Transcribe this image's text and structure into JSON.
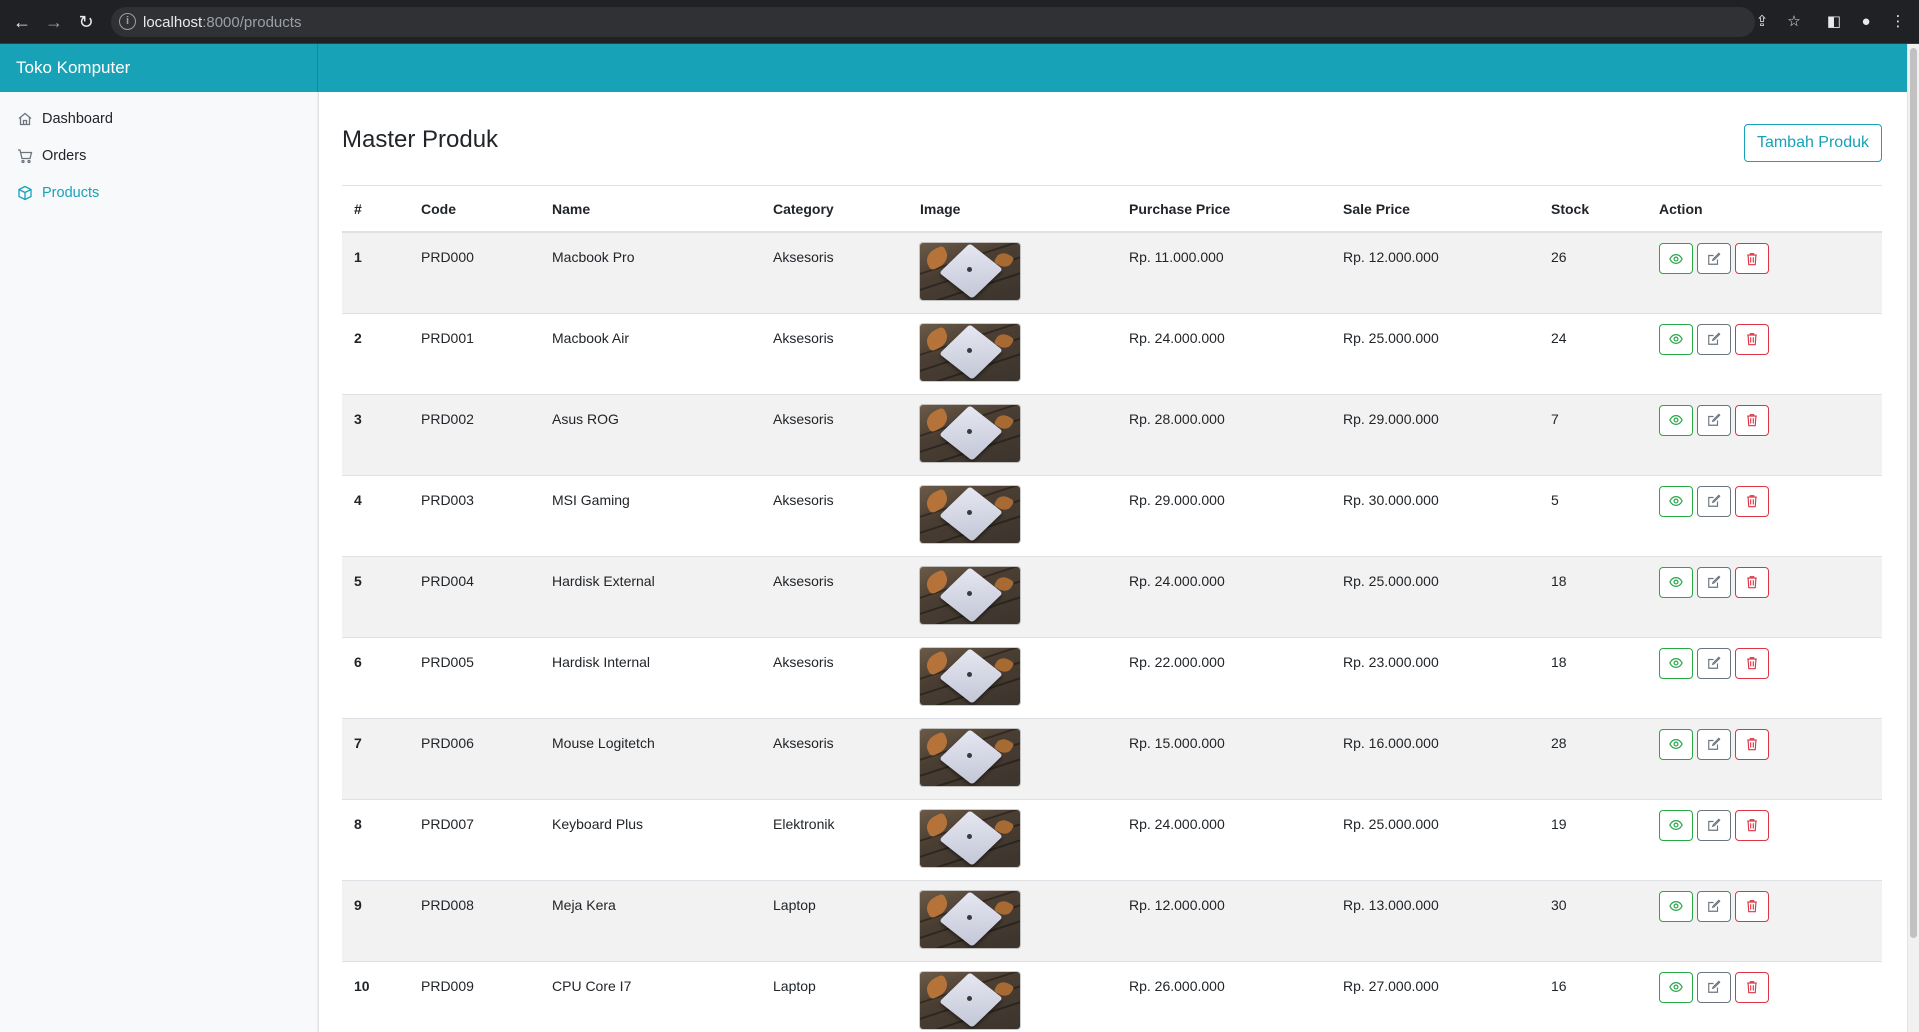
{
  "browser": {
    "url_host": "localhost",
    "url_path": ":8000/products"
  },
  "app": {
    "brand": "Toko Komputer"
  },
  "sidebar": {
    "items": [
      {
        "label": "Dashboard",
        "icon": "home-icon",
        "active": false
      },
      {
        "label": "Orders",
        "icon": "cart-icon",
        "active": false
      },
      {
        "label": "Products",
        "icon": "box-icon",
        "active": true
      }
    ]
  },
  "main": {
    "title": "Master Produk",
    "add_button": "Tambah Produk"
  },
  "table": {
    "headers": [
      "#",
      "Code",
      "Name",
      "Category",
      "Image",
      "Purchase Price",
      "Sale Price",
      "Stock",
      "Action"
    ],
    "rows": [
      {
        "num": "1",
        "code": "PRD000",
        "name": "Macbook Pro",
        "category": "Aksesoris",
        "purchase": "Rp. 11.000.000",
        "sale": "Rp. 12.000.000",
        "stock": "26"
      },
      {
        "num": "2",
        "code": "PRD001",
        "name": "Macbook Air",
        "category": "Aksesoris",
        "purchase": "Rp. 24.000.000",
        "sale": "Rp. 25.000.000",
        "stock": "24"
      },
      {
        "num": "3",
        "code": "PRD002",
        "name": "Asus ROG",
        "category": "Aksesoris",
        "purchase": "Rp. 28.000.000",
        "sale": "Rp. 29.000.000",
        "stock": "7"
      },
      {
        "num": "4",
        "code": "PRD003",
        "name": "MSI Gaming",
        "category": "Aksesoris",
        "purchase": "Rp. 29.000.000",
        "sale": "Rp. 30.000.000",
        "stock": "5"
      },
      {
        "num": "5",
        "code": "PRD004",
        "name": "Hardisk External",
        "category": "Aksesoris",
        "purchase": "Rp. 24.000.000",
        "sale": "Rp. 25.000.000",
        "stock": "18"
      },
      {
        "num": "6",
        "code": "PRD005",
        "name": "Hardisk Internal",
        "category": "Aksesoris",
        "purchase": "Rp. 22.000.000",
        "sale": "Rp. 23.000.000",
        "stock": "18"
      },
      {
        "num": "7",
        "code": "PRD006",
        "name": "Mouse Logitetch",
        "category": "Aksesoris",
        "purchase": "Rp. 15.000.000",
        "sale": "Rp. 16.000.000",
        "stock": "28"
      },
      {
        "num": "8",
        "code": "PRD007",
        "name": "Keyboard Plus",
        "category": "Elektronik",
        "purchase": "Rp. 24.000.000",
        "sale": "Rp. 25.000.000",
        "stock": "19"
      },
      {
        "num": "9",
        "code": "PRD008",
        "name": "Meja Kera",
        "category": "Laptop",
        "purchase": "Rp. 12.000.000",
        "sale": "Rp. 13.000.000",
        "stock": "30"
      },
      {
        "num": "10",
        "code": "PRD009",
        "name": "CPU Core I7",
        "category": "Laptop",
        "purchase": "Rp. 26.000.000",
        "sale": "Rp. 27.000.000",
        "stock": "16"
      }
    ]
  },
  "colors": {
    "accent": "#17a2b8",
    "view": "#28a745",
    "edit": "#6c757d",
    "delete": "#dc3545"
  }
}
